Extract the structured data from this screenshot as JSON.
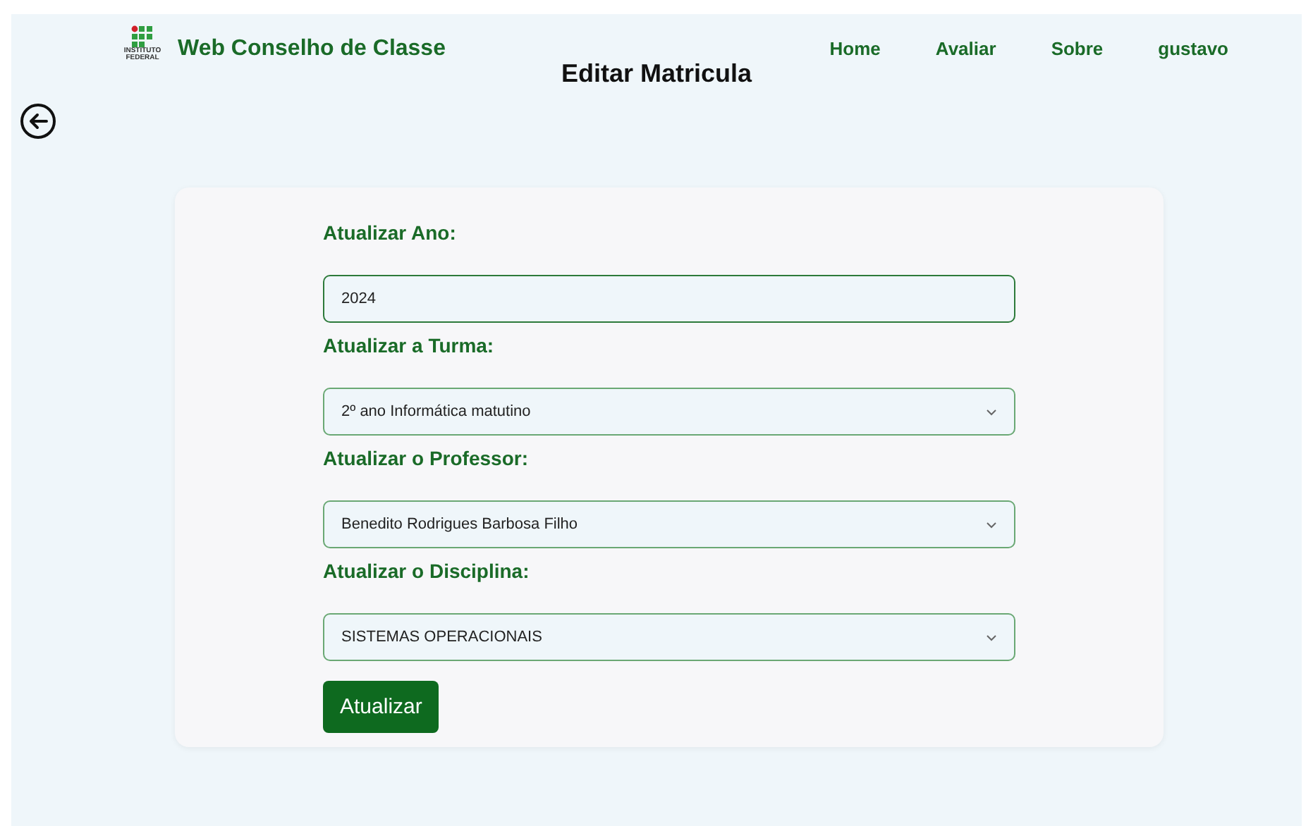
{
  "header": {
    "logo": {
      "lines": [
        "INSTITUTO",
        "FEDERAL"
      ]
    },
    "brand": "Web Conselho de Classe",
    "nav": [
      {
        "label": "Home"
      },
      {
        "label": "Avaliar"
      },
      {
        "label": "Sobre"
      },
      {
        "label": "gustavo"
      }
    ]
  },
  "page_title": "Editar Matricula",
  "form": {
    "fields": [
      {
        "label": "Atualizar Ano:",
        "kind": "input",
        "value": "2024"
      },
      {
        "label": "Atualizar a Turma:",
        "kind": "select",
        "value": "2º ano Informática matutino"
      },
      {
        "label": "Atualizar o Professor:",
        "kind": "select",
        "value": "Benedito Rodrigues Barbosa Filho"
      },
      {
        "label": "Atualizar o Disciplina:",
        "kind": "select",
        "value": "SISTEMAS OPERACIONAIS"
      }
    ],
    "submit": "Atualizar"
  }
}
